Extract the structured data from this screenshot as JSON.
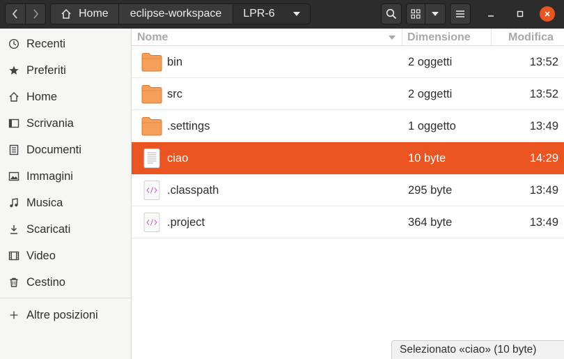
{
  "header": {
    "breadcrumbs": [
      {
        "label": "Home"
      },
      {
        "label": "eclipse-workspace"
      },
      {
        "label": "LPR-6"
      }
    ]
  },
  "sidebar": {
    "items": [
      {
        "label": "Recenti",
        "icon": "clock-icon"
      },
      {
        "label": "Preferiti",
        "icon": "star-icon"
      },
      {
        "label": "Home",
        "icon": "home-icon"
      },
      {
        "label": "Scrivania",
        "icon": "desktop-icon"
      },
      {
        "label": "Documenti",
        "icon": "document-icon"
      },
      {
        "label": "Immagini",
        "icon": "image-icon"
      },
      {
        "label": "Musica",
        "icon": "music-icon"
      },
      {
        "label": "Scaricati",
        "icon": "download-icon"
      },
      {
        "label": "Video",
        "icon": "video-icon"
      },
      {
        "label": "Cestino",
        "icon": "trash-icon"
      }
    ],
    "other_locations": {
      "label": "Altre posizioni",
      "icon": "plus-icon"
    }
  },
  "columns": {
    "name": "Nome",
    "size": "Dimensione",
    "modified": "Modifica"
  },
  "files": [
    {
      "name": "bin",
      "size": "2 oggetti",
      "modified": "13:52",
      "type": "folder",
      "selected": false
    },
    {
      "name": "src",
      "size": "2 oggetti",
      "modified": "13:52",
      "type": "folder",
      "selected": false
    },
    {
      "name": ".settings",
      "size": "1 oggetto",
      "modified": "13:49",
      "type": "folder",
      "selected": false
    },
    {
      "name": "ciao",
      "size": "10 byte",
      "modified": "14:29",
      "type": "text",
      "selected": true
    },
    {
      "name": ".classpath",
      "size": "295 byte",
      "modified": "13:49",
      "type": "xml",
      "selected": false
    },
    {
      "name": ".project",
      "size": "364 byte",
      "modified": "13:49",
      "type": "xml",
      "selected": false
    }
  ],
  "status": "Selezionato «ciao» (10 byte)",
  "colors": {
    "accent": "#e95420",
    "folder": "#f5a05a",
    "headerbar": "#2c2c2c"
  }
}
